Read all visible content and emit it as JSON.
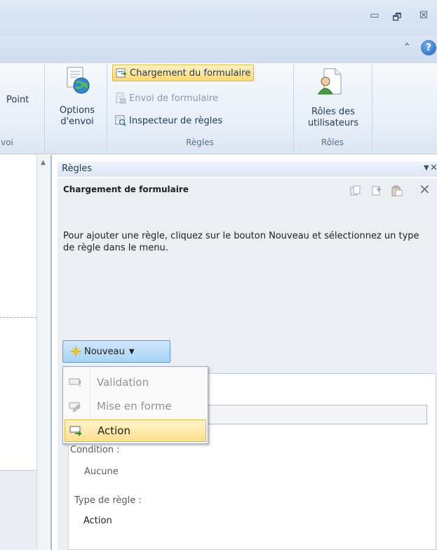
{
  "window": {
    "minimize_glyph": "▭",
    "restore_glyph": "🗗",
    "close_glyph": "☒",
    "collapse_ribbon_glyph": "⌃",
    "help_glyph": "?"
  },
  "ribbon": {
    "partial_button_label": "Point",
    "partial_group_label": "voi",
    "options_envoi": {
      "label_line1": "Options",
      "label_line2": "d'envoi",
      "icon": "send-options-globe-icon"
    },
    "rules_group": {
      "label": "Règles",
      "items": [
        {
          "label": "Chargement du formulaire",
          "state": "active",
          "icon": "form-load-icon"
        },
        {
          "label": "Envoi de formulaire",
          "state": "disabled",
          "icon": "form-submit-icon"
        },
        {
          "label": "Inspecteur de règles",
          "state": "normal",
          "icon": "rule-inspector-icon"
        }
      ]
    },
    "roles_group": {
      "label": "Rôles",
      "button_line1": "Rôles des",
      "button_line2": "utilisateurs",
      "icon": "user-roles-icon"
    }
  },
  "task_pane": {
    "title": "Règles",
    "menu_glyph": "▼",
    "close_glyph": "✕",
    "subheader": "Chargement de formulaire",
    "toolbar_icons": [
      "copy-icon",
      "copy-rule-icon",
      "paste-icon",
      "delete-icon"
    ],
    "delete_glyph": "✕",
    "description": "Pour ajouter une règle, cliquez sur le bouton Nouveau et sélectionnez un type de règle dans le menu.",
    "new_button": {
      "label": "Nouveau",
      "caret": "▼",
      "icon": "sparkle-new-icon"
    },
    "details": {
      "condition_label": "Condition :",
      "condition_value": "Aucune",
      "rule_type_label": "Type de règle :",
      "rule_type_value": "Action"
    }
  },
  "new_menu": {
    "items": [
      {
        "label": "Validation",
        "state": "disabled",
        "icon": "validation-icon"
      },
      {
        "label": "Mise en forme",
        "state": "disabled",
        "icon": "formatting-icon"
      },
      {
        "label": "Action",
        "state": "hover",
        "icon": "action-icon"
      }
    ]
  },
  "colors": {
    "active_highlight": "#ffd86f",
    "new_button": "#a9d3f5",
    "pane_background": "#ebeff4"
  }
}
